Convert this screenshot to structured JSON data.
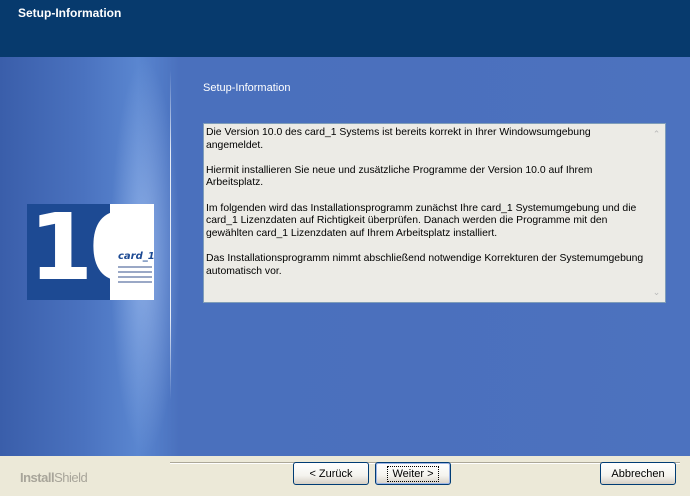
{
  "window": {
    "title": "Setup-Information"
  },
  "logo": {
    "number": "10",
    "brand": "card_1"
  },
  "section": {
    "title": "Setup-Information"
  },
  "info": {
    "paragraphs": [
      "Die Version 10.0 des card_1 Systems ist bereits korrekt in Ihrer Windowsumgebung\nangemeldet.",
      "Hiermit installieren Sie neue und zusätzliche Programme der Version 10.0 auf Ihrem\nArbeitsplatz.",
      "Im folgenden wird das Installationsprogramm zunächst Ihre card_1 Systemumgebung und die\ncard_1 Lizenzdaten auf Richtigkeit überprüfen. Danach werden die Programme mit den\ngewählten card_1 Lizenzdaten auf Ihrem Arbeitsplatz installiert.",
      "Das Installationsprogramm nimmt abschließend notwendige Korrekturen der Systemumgebung\nautomatisch vor."
    ]
  },
  "footer": {
    "brand_bold": "Install",
    "brand_thin": "Shield",
    "back_label": "< Zurück",
    "next_label": "Weiter >",
    "cancel_label": "Abbrechen"
  },
  "icons": {
    "scroll_up": "up-arrow-icon",
    "scroll_down": "down-arrow-icon"
  }
}
